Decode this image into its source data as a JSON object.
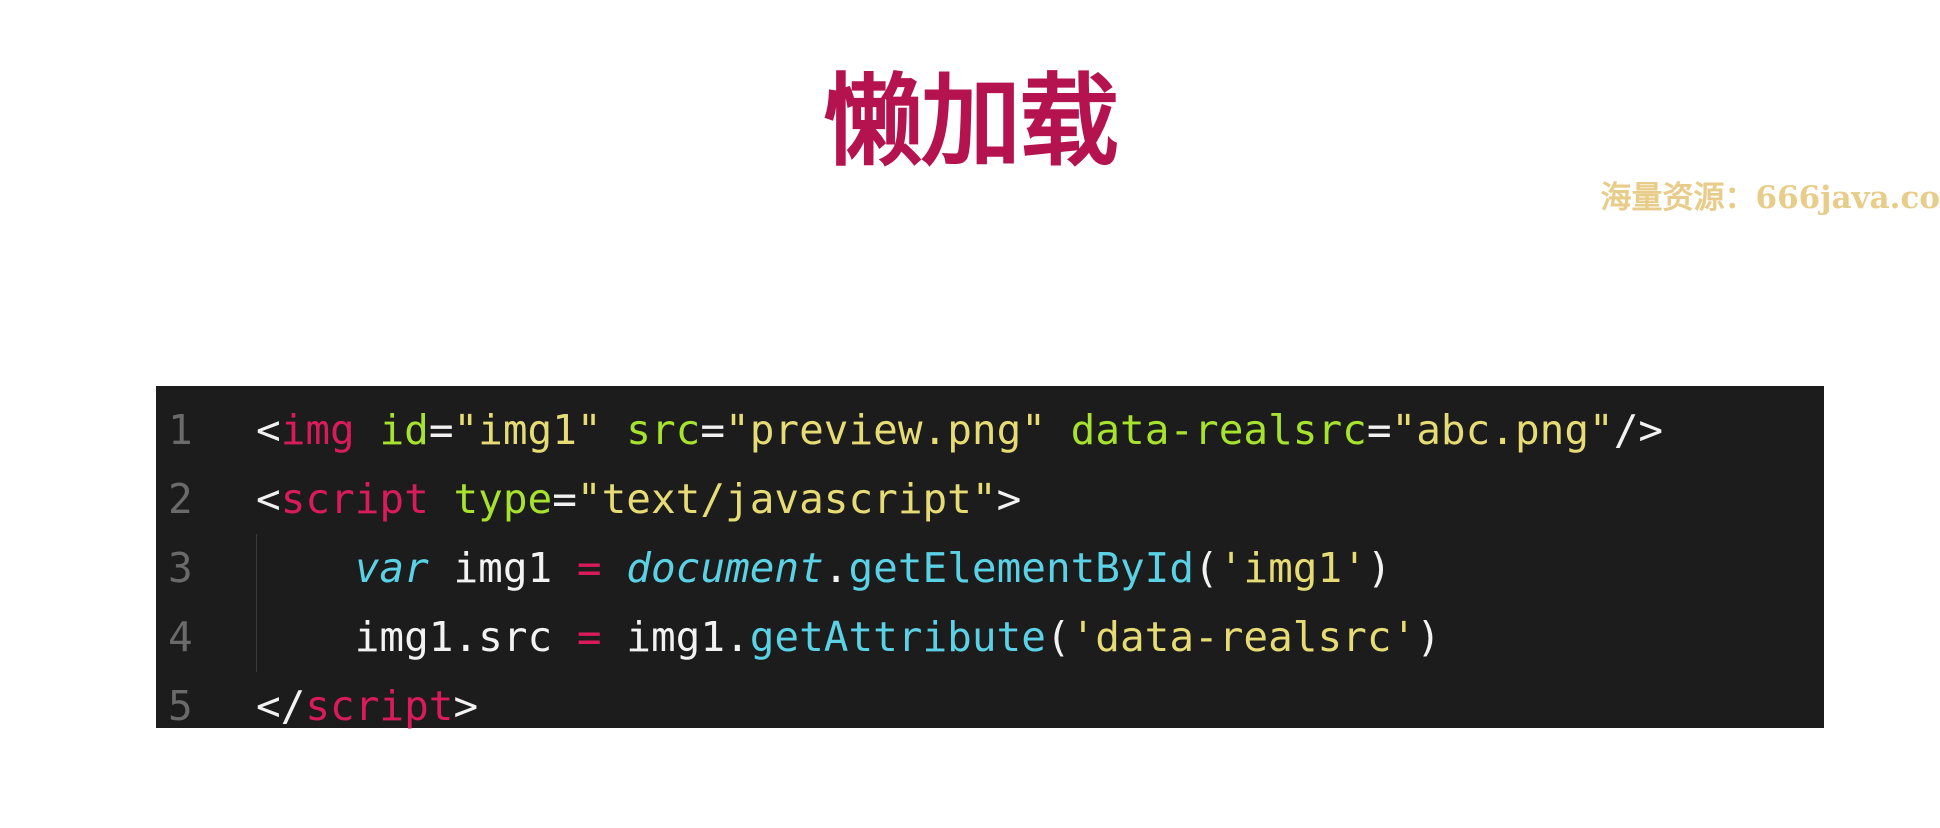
{
  "slide": {
    "title": "懒加载",
    "watermark": "海量资源：666java.co"
  },
  "code": {
    "lines": [
      {
        "number": "1",
        "tokens": [
          {
            "text": "<",
            "type": "default"
          },
          {
            "text": "img",
            "type": "tag"
          },
          {
            "text": " ",
            "type": "default"
          },
          {
            "text": "id",
            "type": "attr"
          },
          {
            "text": "=",
            "type": "default"
          },
          {
            "text": "\"img1\"",
            "type": "string"
          },
          {
            "text": " ",
            "type": "default"
          },
          {
            "text": "src",
            "type": "attr"
          },
          {
            "text": "=",
            "type": "default"
          },
          {
            "text": "\"preview.png\"",
            "type": "string"
          },
          {
            "text": " ",
            "type": "default"
          },
          {
            "text": "data-realsrc",
            "type": "attr"
          },
          {
            "text": "=",
            "type": "default"
          },
          {
            "text": "\"abc.png\"",
            "type": "string"
          },
          {
            "text": "/>",
            "type": "default"
          }
        ]
      },
      {
        "number": "2",
        "tokens": [
          {
            "text": "<",
            "type": "default"
          },
          {
            "text": "script",
            "type": "tag"
          },
          {
            "text": " ",
            "type": "default"
          },
          {
            "text": "type",
            "type": "attr"
          },
          {
            "text": "=",
            "type": "default"
          },
          {
            "text": "\"text/javascript\"",
            "type": "string"
          },
          {
            "text": ">",
            "type": "default"
          }
        ]
      },
      {
        "number": "3",
        "indent": true,
        "tokens": [
          {
            "text": "    ",
            "type": "default"
          },
          {
            "text": "var",
            "type": "keyword"
          },
          {
            "text": " img1 ",
            "type": "default"
          },
          {
            "text": "=",
            "type": "operator"
          },
          {
            "text": " ",
            "type": "default"
          },
          {
            "text": "document",
            "type": "global"
          },
          {
            "text": ".",
            "type": "default"
          },
          {
            "text": "getElementById",
            "type": "func"
          },
          {
            "text": "(",
            "type": "default"
          },
          {
            "text": "'img1'",
            "type": "string"
          },
          {
            "text": ")",
            "type": "default"
          }
        ]
      },
      {
        "number": "4",
        "indent": true,
        "tokens": [
          {
            "text": "    img1.src ",
            "type": "default"
          },
          {
            "text": "=",
            "type": "operator"
          },
          {
            "text": " img1.",
            "type": "default"
          },
          {
            "text": "getAttribute",
            "type": "func"
          },
          {
            "text": "(",
            "type": "default"
          },
          {
            "text": "'data-realsrc'",
            "type": "string"
          },
          {
            "text": ")",
            "type": "default"
          }
        ]
      },
      {
        "number": "5",
        "tokens": [
          {
            "text": "</",
            "type": "default"
          },
          {
            "text": "script",
            "type": "tag"
          },
          {
            "text": ">",
            "type": "default"
          }
        ]
      }
    ]
  }
}
